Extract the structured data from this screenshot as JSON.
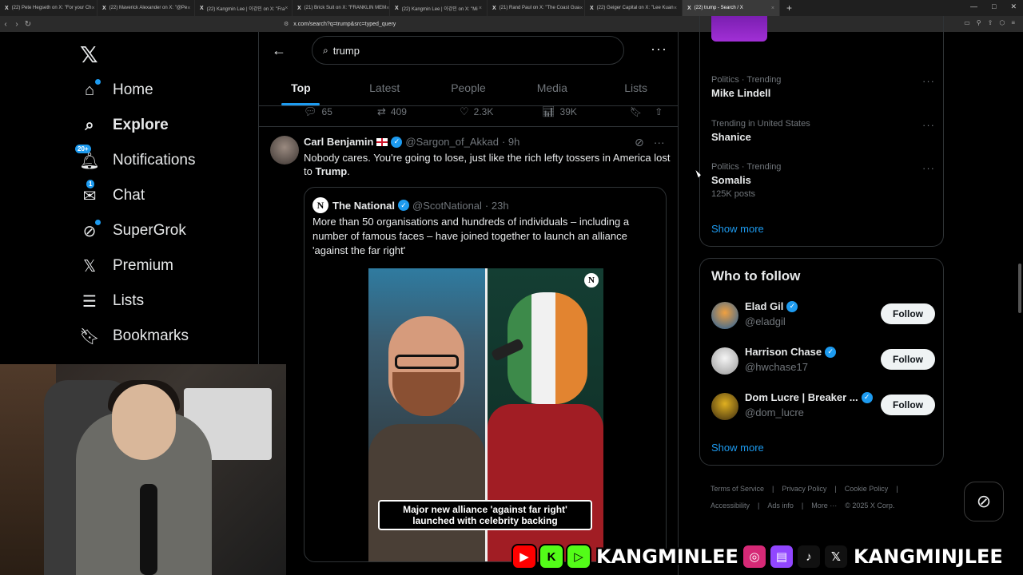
{
  "browser": {
    "tabs": [
      {
        "title": "(22) Pete Hegseth on X: \"For your Ch"
      },
      {
        "title": "(22) Maverick Alexander on X: \"@Pe"
      },
      {
        "title": "(22) Kangmin Lee | 이강민 on X: \"Fra"
      },
      {
        "title": "(21) Brick Suit on X: \"FRANKLIN MEM"
      },
      {
        "title": "(22) Kangmin Lee | 이강민 on X: \"Mi"
      },
      {
        "title": "(21) Rand Paul on X: \"The Coast Gua"
      },
      {
        "title": "(22) Geiger Capital on X: \"Lee Kuan"
      },
      {
        "title": "(22) trump - Search / X"
      }
    ],
    "url": "x.com/search?q=trump&src=typed_query"
  },
  "nav": {
    "items": [
      {
        "label": "Home",
        "icon": "home-icon"
      },
      {
        "label": "Explore",
        "icon": "search-icon"
      },
      {
        "label": "Notifications",
        "icon": "bell-icon",
        "badge": "20+"
      },
      {
        "label": "Chat",
        "icon": "mail-icon",
        "badge": "1"
      },
      {
        "label": "SuperGrok",
        "icon": "grok-icon"
      },
      {
        "label": "Premium",
        "icon": "x-icon"
      },
      {
        "label": "Lists",
        "icon": "list-icon"
      },
      {
        "label": "Bookmarks",
        "icon": "bookmark-icon"
      }
    ]
  },
  "search": {
    "query": "trump",
    "tabs": [
      "Top",
      "Latest",
      "People",
      "Media",
      "Lists"
    ],
    "active_tab": "Top"
  },
  "previous_post": {
    "replies": "65",
    "reposts": "409",
    "likes": "2.3K",
    "views": "39K"
  },
  "post": {
    "author": "Carl Benjamin",
    "handle": "@Sargon_of_Akkad",
    "time": "· 9h",
    "text_before": "Nobody cares. You're going to lose,  just like the rich lefty tossers in America lost to ",
    "text_bold": "Trump",
    "text_after": ".",
    "quote": {
      "avatar_letter": "N",
      "author": "The National",
      "handle": "@ScotNational",
      "time": "· 23h",
      "text": "More than 50 organisations and hundreds of individuals – including a number of famous faces – have joined together to launch an alliance 'against the far right'",
      "image_logo": "N",
      "image_caption_1": "Major new alliance 'against far right'",
      "image_caption_2": "launched with celebrity backing"
    }
  },
  "trends": [
    {
      "category": "Politics · Trending",
      "title": "Mike Lindell",
      "count": ""
    },
    {
      "category": "Trending in United States",
      "title": "Shanice",
      "count": ""
    },
    {
      "category": "Politics · Trending",
      "title": "Somalis",
      "count": "125K posts"
    }
  ],
  "trends_show_more": "Show more",
  "who_to_follow": {
    "title": "Who to follow",
    "button_label": "Follow",
    "show_more": "Show more",
    "accounts": [
      {
        "name": "Elad Gil",
        "handle": "@eladgil"
      },
      {
        "name": "Harrison Chase",
        "handle": "@hwchase17"
      },
      {
        "name": "Dom Lucre | Breaker ...",
        "handle": "@dom_lucre"
      }
    ]
  },
  "footer": {
    "links": [
      "Terms of Service",
      "|",
      "Privacy Policy",
      "|",
      "Cookie Policy",
      "|",
      "Accessibility",
      "|",
      "Ads info",
      "|",
      "More ···",
      "© 2025 X Corp."
    ]
  },
  "banner": {
    "handle1": "KANGMINLEE",
    "handle2": "KANGMINJLEE"
  },
  "colors": {
    "accent": "#1d9bf0",
    "background": "#000000",
    "border": "#2f3336",
    "muted": "#71767b"
  }
}
